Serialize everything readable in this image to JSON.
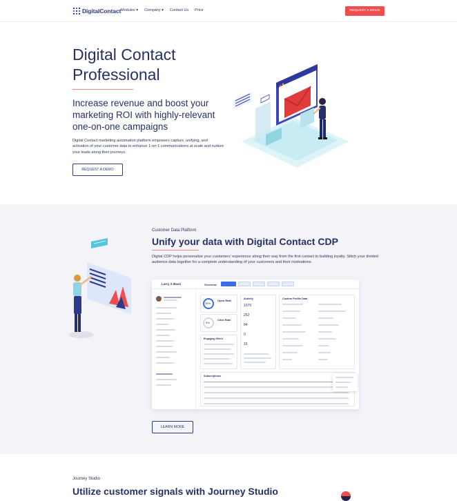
{
  "nav": {
    "logo_text": "DigitalContact",
    "links": [
      "Modules ▾",
      "Company ▾",
      "Contact Us",
      "Price"
    ],
    "cta": "REQUEST A DEMO"
  },
  "hero": {
    "title": "Digital Contact Professional",
    "subtitle": "Increase revenue and boost your marketing ROI with highly-relevant one-on-one campaigns",
    "body": "Digital Contact marketing automation platform empowers capture, unifying, and activation of your customer data to enhance 1-on-1 communications at scale and nurture your leads along their journeys.",
    "button": "REQUEST A DEMO"
  },
  "cdp": {
    "kicker": "Customer Data Platform",
    "title": "Unify your data with Digital Contact CDP",
    "body": "Digital CDP helps personalize your customers' experience along their way from the first contact to building loyalty. Stitch your divided audience data together for a complete understanding of your customers and their motivations.",
    "button": "LEARN MORE",
    "screenshot": {
      "contact_name": "Larry X Bass",
      "tab": "Overview",
      "open_rate_label": "Open Rate",
      "open_rate_value": "28%",
      "click_rate_label": "Click Rate",
      "click_rate_value": "5%",
      "activity_label": "Activity",
      "activity_values": [
        "1070",
        "252",
        "84",
        "0",
        "15"
      ],
      "profile_label": "Custom Profile Data",
      "engaging_label": "Engaging Offers",
      "subscriptions_label": "Subscriptions"
    }
  },
  "journey": {
    "kicker": "Journey Studio",
    "title": "Utilize customer signals with Journey Studio"
  },
  "colors": {
    "brand": "#2b3a8c",
    "accent": "#ee4e4e",
    "section_bg": "#f4f4f8"
  }
}
